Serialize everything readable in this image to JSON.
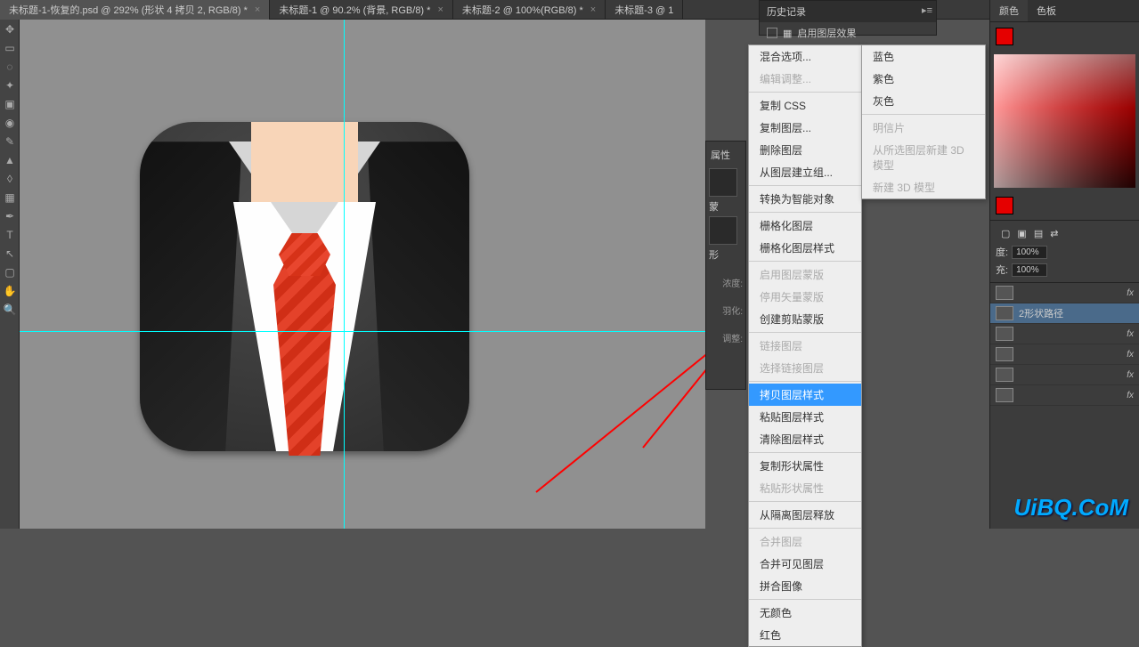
{
  "tabs": [
    {
      "label": "未标题-1-恢复的.psd @ 292% (形状 4 拷贝 2, RGB/8) *"
    },
    {
      "label": "未标题-1 @ 90.2% (背景, RGB/8) *"
    },
    {
      "label": "未标题-2 @ 100%(RGB/8) *"
    },
    {
      "label": "未标题-3 @ 1"
    }
  ],
  "history": {
    "title": "历史记录",
    "row": "启用图层效果"
  },
  "props": {
    "title": "属性",
    "mask": "蒙",
    "shape": "形",
    "density": "浓度:",
    "feather": "羽化:",
    "adjust": "调整:"
  },
  "ctx": {
    "items": [
      [
        "混合选项...",
        "编辑调整..."
      ],
      [
        "复制 CSS",
        "复制图层...",
        "删除图层",
        "从图层建立组..."
      ],
      [
        "转换为智能对象"
      ],
      [
        "栅格化图层",
        "栅格化图层样式"
      ],
      [
        "启用图层蒙版",
        "停用矢量蒙版",
        "创建剪贴蒙版"
      ],
      [
        "链接图层",
        "选择链接图层"
      ],
      [
        "拷贝图层样式",
        "粘贴图层样式",
        "清除图层样式"
      ],
      [
        "复制形状属性",
        "粘贴形状属性"
      ],
      [
        "从隔离图层释放"
      ],
      [
        "合并图层",
        "合并可见图层",
        "拼合图像"
      ],
      [
        "无颜色",
        "红色"
      ]
    ],
    "disabled": [
      "编辑调整...",
      "启用图层蒙版",
      "停用矢量蒙版",
      "链接图层",
      "选择链接图层",
      "粘贴形状属性",
      "合并图层"
    ],
    "selected": "拷贝图层样式"
  },
  "submenu": {
    "colors": [
      "蓝色",
      "紫色",
      "灰色"
    ],
    "group2": [
      "明信片",
      "从所选图层新建 3D 模型",
      "新建 3D 模型"
    ]
  },
  "right": {
    "tabs1": [
      "颜色",
      "色板"
    ],
    "density": "度:",
    "dval": "100%",
    "flow": "充:",
    "fval": "100%",
    "layer": "2形状路径"
  },
  "watermark": "UiBQ.CoM"
}
